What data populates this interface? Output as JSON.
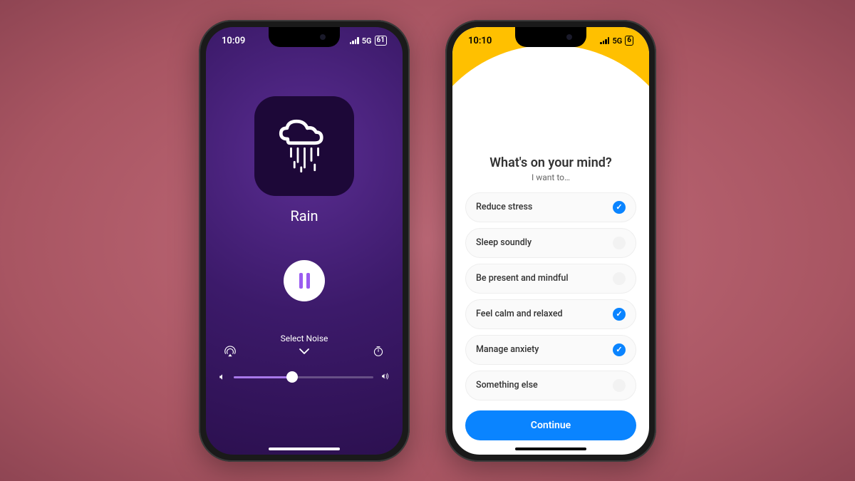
{
  "left": {
    "status": {
      "time": "10:09",
      "network": "5G",
      "battery": "61"
    },
    "track_title": "Rain",
    "select_noise_label": "Select Noise",
    "volume_percent": 42
  },
  "right": {
    "status": {
      "time": "10:10",
      "network": "5G",
      "battery": "6"
    },
    "question": "What's on your mind?",
    "subtitle": "I want to…",
    "options": [
      {
        "label": "Reduce stress",
        "selected": true
      },
      {
        "label": "Sleep soundly",
        "selected": false
      },
      {
        "label": "Be present and mindful",
        "selected": false
      },
      {
        "label": "Feel calm and relaxed",
        "selected": true
      },
      {
        "label": "Manage anxiety",
        "selected": true
      },
      {
        "label": "Something else",
        "selected": false
      }
    ],
    "continue_label": "Continue"
  },
  "colors": {
    "accent_blue": "#0a84ff",
    "accent_purple": "#9b5cf0",
    "header_yellow": "#ffc000"
  }
}
